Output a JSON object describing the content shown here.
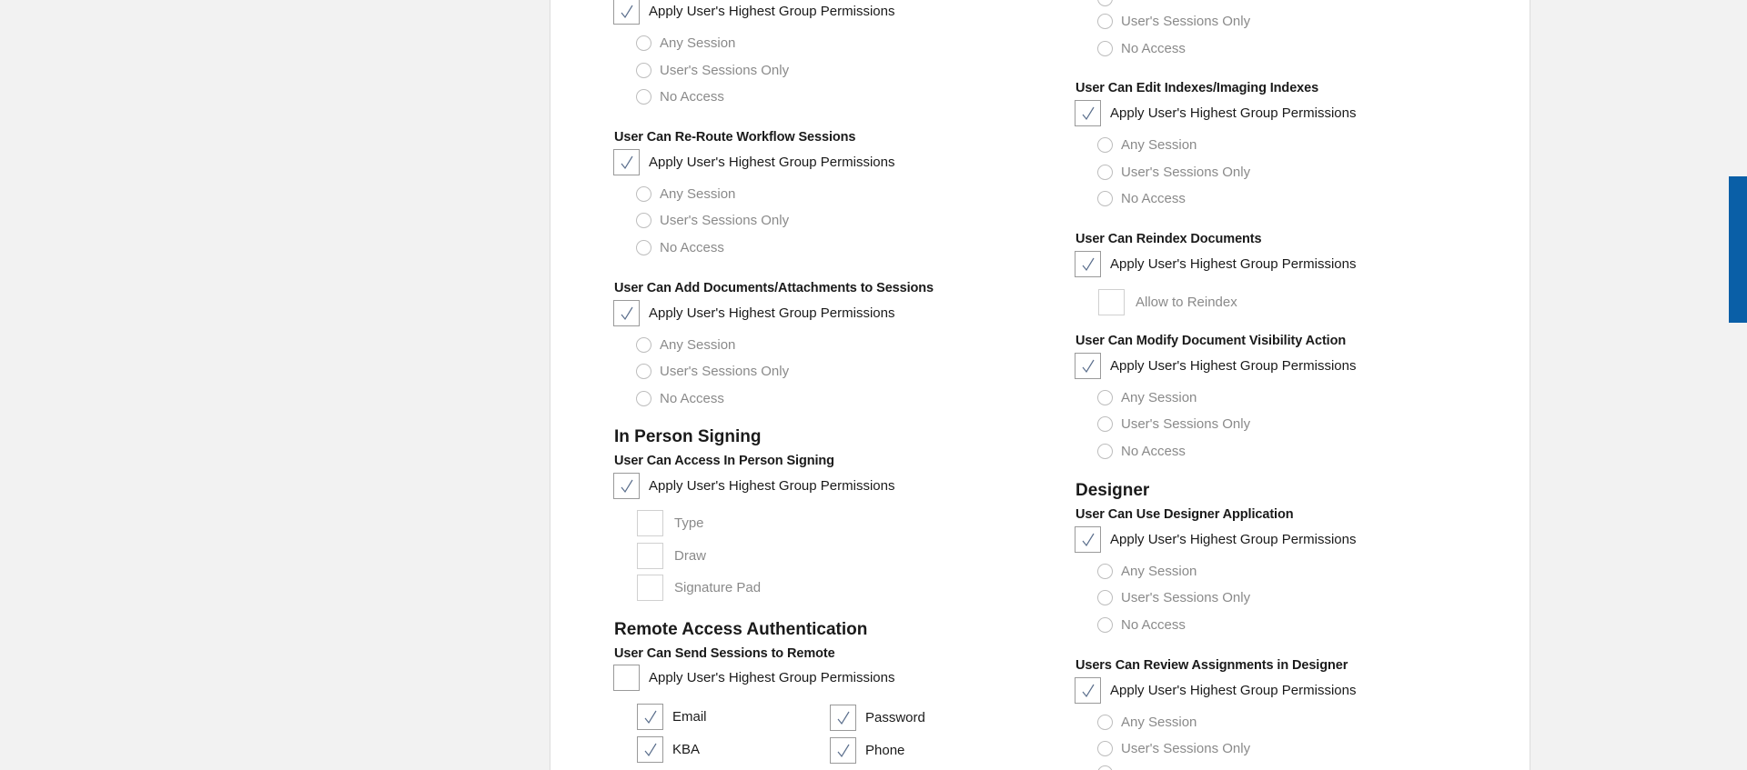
{
  "left": {
    "top_block": {
      "apply": "Apply User's Highest Group Permissions",
      "options": [
        "Any Session",
        "User's Sessions Only",
        "No Access"
      ]
    },
    "reroute": {
      "title": "User Can Re-Route Workflow Sessions",
      "apply": "Apply User's Highest Group Permissions",
      "options": [
        "Any Session",
        "User's Sessions Only",
        "No Access"
      ]
    },
    "add_docs": {
      "title": "User Can Add Documents/Attachments to Sessions",
      "apply": "Apply User's Highest Group Permissions",
      "options": [
        "Any Session",
        "User's Sessions Only",
        "No Access"
      ]
    },
    "in_person": {
      "heading": "In Person Signing",
      "title": "User Can Access In Person Signing",
      "apply": "Apply User's Highest Group Permissions",
      "options": [
        "Type",
        "Draw",
        "Signature Pad"
      ]
    },
    "remote": {
      "heading": "Remote Access Authentication",
      "title": "User Can Send Sessions to Remote",
      "apply": "Apply User's Highest Group Permissions",
      "options": [
        "Email",
        "Password",
        "KBA",
        "Phone"
      ]
    }
  },
  "right": {
    "top_block": {
      "options": [
        "User's Sessions Only",
        "No Access"
      ]
    },
    "edit_indexes": {
      "title": "User Can Edit Indexes/Imaging Indexes",
      "apply": "Apply User's Highest Group Permissions",
      "options": [
        "Any Session",
        "User's Sessions Only",
        "No Access"
      ]
    },
    "reindex": {
      "title": "User Can Reindex Documents",
      "apply": "Apply User's Highest Group Permissions",
      "allow": "Allow to Reindex"
    },
    "visibility": {
      "title": "User Can Modify Document Visibility Action",
      "apply": "Apply User's Highest Group Permissions",
      "options": [
        "Any Session",
        "User's Sessions Only",
        "No Access"
      ]
    },
    "designer": {
      "heading": "Designer",
      "title": "User Can Use Designer Application",
      "apply": "Apply User's Highest Group Permissions",
      "options": [
        "Any Session",
        "User's Sessions Only",
        "No Access"
      ]
    },
    "review": {
      "title": "Users Can Review Assignments in Designer",
      "apply": "Apply User's Highest Group Permissions",
      "options": [
        "Any Session",
        "User's Sessions Only"
      ]
    }
  },
  "colors": {
    "scrollbar": "#0a5fa7",
    "check": "#5a6e8c",
    "muted_text": "#8a8a8a"
  }
}
